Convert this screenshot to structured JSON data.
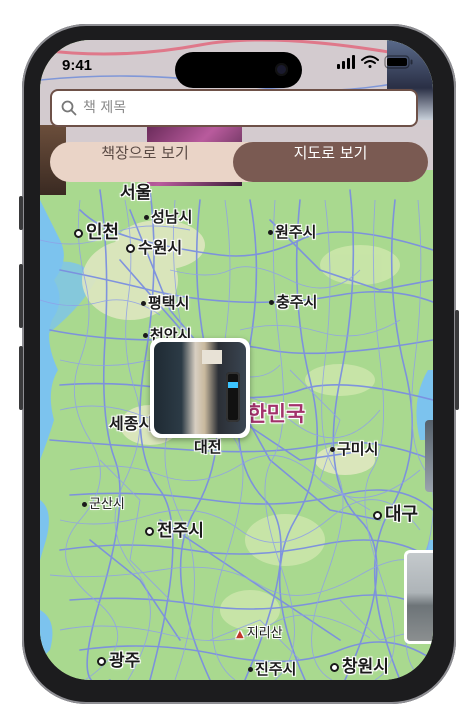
{
  "status_bar": {
    "time": "9:41"
  },
  "search": {
    "placeholder": "책 제목",
    "value": ""
  },
  "view_toggle": {
    "bookshelf_label": "책장으로 보기",
    "map_label": "지도로 보기",
    "selected": "map"
  },
  "map": {
    "country_label": "대한민국",
    "cities": [
      {
        "name": "인천",
        "marker": "dot"
      },
      {
        "name": "성남시",
        "marker": "small"
      },
      {
        "name": "수원시",
        "marker": "dot"
      },
      {
        "name": "원주시",
        "marker": "small"
      },
      {
        "name": "평택시",
        "marker": "small"
      },
      {
        "name": "충주시",
        "marker": "small"
      },
      {
        "name": "천안시",
        "marker": "small"
      },
      {
        "name": "세종시",
        "marker": "none"
      },
      {
        "name": "대전",
        "marker": "none"
      },
      {
        "name": "구미시",
        "marker": "small"
      },
      {
        "name": "군산시",
        "marker": "small"
      },
      {
        "name": "전주시",
        "marker": "dot"
      },
      {
        "name": "대구",
        "marker": "dot"
      },
      {
        "name": "지리산",
        "marker": "mountain"
      },
      {
        "name": "광주",
        "marker": "dot"
      },
      {
        "name": "진주시",
        "marker": "small"
      },
      {
        "name": "창원시",
        "marker": "dot"
      }
    ],
    "partial_labels": {
      "top_label": "서울"
    }
  },
  "colors": {
    "accent": "#7a5a52",
    "segment_bg": "#ead4c7",
    "land": "#a9d98f",
    "roads": "#7b8fe0",
    "sea": "#7cc3ee",
    "country_label": "#a2326a"
  }
}
